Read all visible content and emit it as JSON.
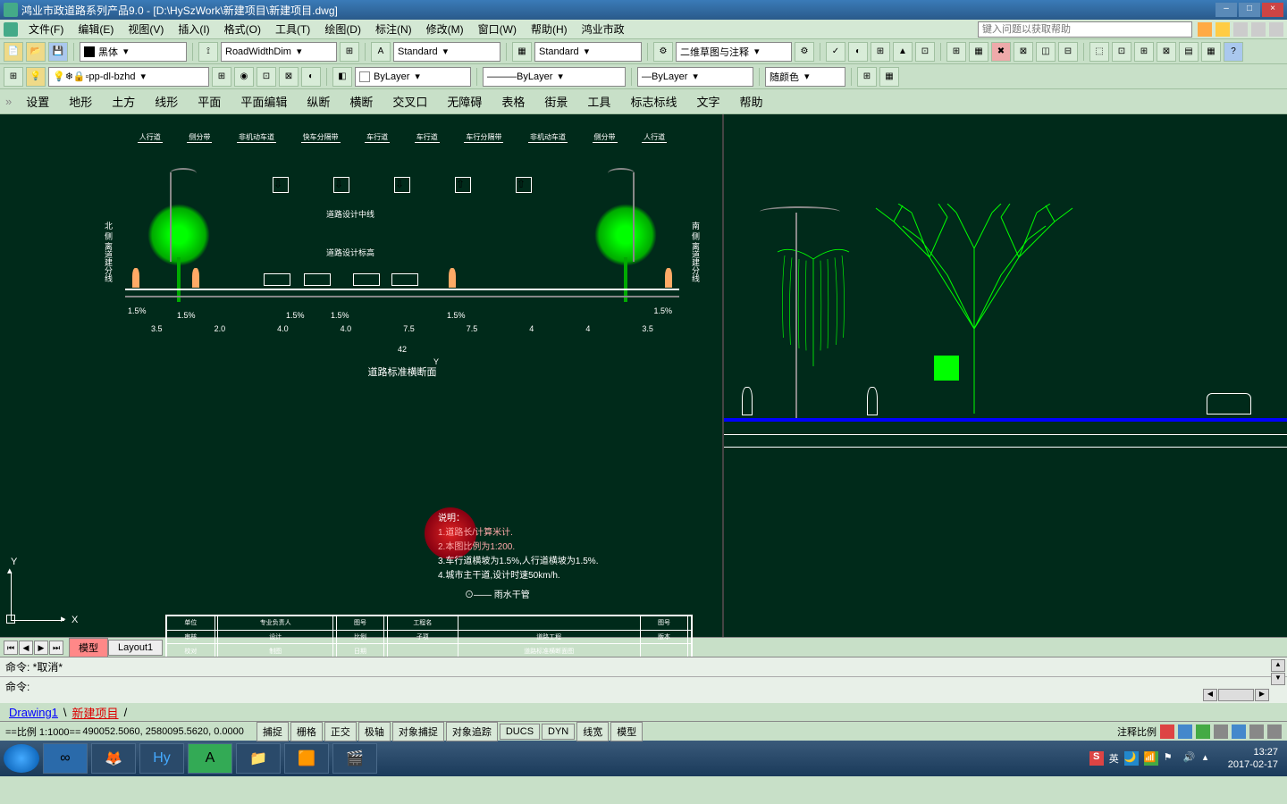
{
  "titlebar": {
    "app": "鸿业市政道路系列产品9.0",
    "file": "[D:\\HySzWork\\新建项目\\新建项目.dwg]"
  },
  "menu": {
    "file": "文件(F)",
    "edit": "编辑(E)",
    "view": "视图(V)",
    "insert": "插入(I)",
    "format": "格式(O)",
    "tools": "工具(T)",
    "draw": "绘图(D)",
    "dim": "标注(N)",
    "modify": "修改(M)",
    "window": "窗口(W)",
    "help": "帮助(H)",
    "hy": "鸿业市政",
    "help_placeholder": "键入问题以获取帮助"
  },
  "toolbar1": {
    "color": "黑体",
    "dimstyle": "RoadWidthDim",
    "textstyle": "Standard",
    "tablestyle": "Standard",
    "workspace": "二维草图与注释"
  },
  "toolbar2": {
    "layer": "pp-dl-bzhd",
    "bylayer1": "ByLayer",
    "bylayer2": "ByLayer",
    "bylayer3": "ByLayer",
    "bycolor": "随颜色"
  },
  "secmenu": {
    "items": [
      "设置",
      "地形",
      "土方",
      "线形",
      "平面",
      "平面编辑",
      "纵断",
      "横断",
      "交叉口",
      "无障碍",
      "表格",
      "街景",
      "工具",
      "标志标线",
      "文字",
      "帮助"
    ]
  },
  "drawing": {
    "lanes": [
      "人行道",
      "侧分带",
      "非机动车道",
      "快车分隔带",
      "车行道",
      "车行道",
      "车行分隔带",
      "非机动车道",
      "侧分带",
      "人行道"
    ],
    "left_label": "北 侧",
    "right_label": "南 侧",
    "side_text": "离道建分线",
    "center1": "道路设计中线",
    "center2": "道路设计标高",
    "section_title": "道路标准横断面",
    "dims_pct": [
      "1.5%",
      "1.5%",
      "1.5%",
      "1.5%",
      "1.5%",
      "1.5%"
    ],
    "dims_w": [
      "3.5",
      "2.0",
      "4.0",
      "4.0",
      "7.5",
      "7.5",
      "4",
      "4",
      "3.5"
    ],
    "total_w": "42",
    "notes_title": "说明：",
    "notes": [
      "1.道路长/计算米计.",
      "2.本图比例为1:200.",
      "3.车行道横坡为1.5%,人行道横坡为1.5%.",
      "4.城市主干道,设计时速50km/h."
    ],
    "rain": "雨水干管",
    "y_axis": "Y",
    "x_axis": "X"
  },
  "tabs": {
    "model": "模型",
    "layout": "Layout1"
  },
  "cmd": {
    "line1": "命令: *取消*",
    "prompt": "命令:"
  },
  "filetabs": {
    "f1": "Drawing1",
    "f2": "新建项目"
  },
  "status": {
    "scale_label": "==比例 1:1000==",
    "coords": "490052.5060, 2580095.5620, 0.0000",
    "buttons": [
      "捕捉",
      "栅格",
      "正交",
      "极轴",
      "对象捕捉",
      "对象追踪",
      "DUCS",
      "DYN",
      "线宽",
      "模型"
    ],
    "annoscale": "注释比例"
  },
  "tray": {
    "ime": "英",
    "time": "13:27",
    "date": "2017-02-17"
  }
}
